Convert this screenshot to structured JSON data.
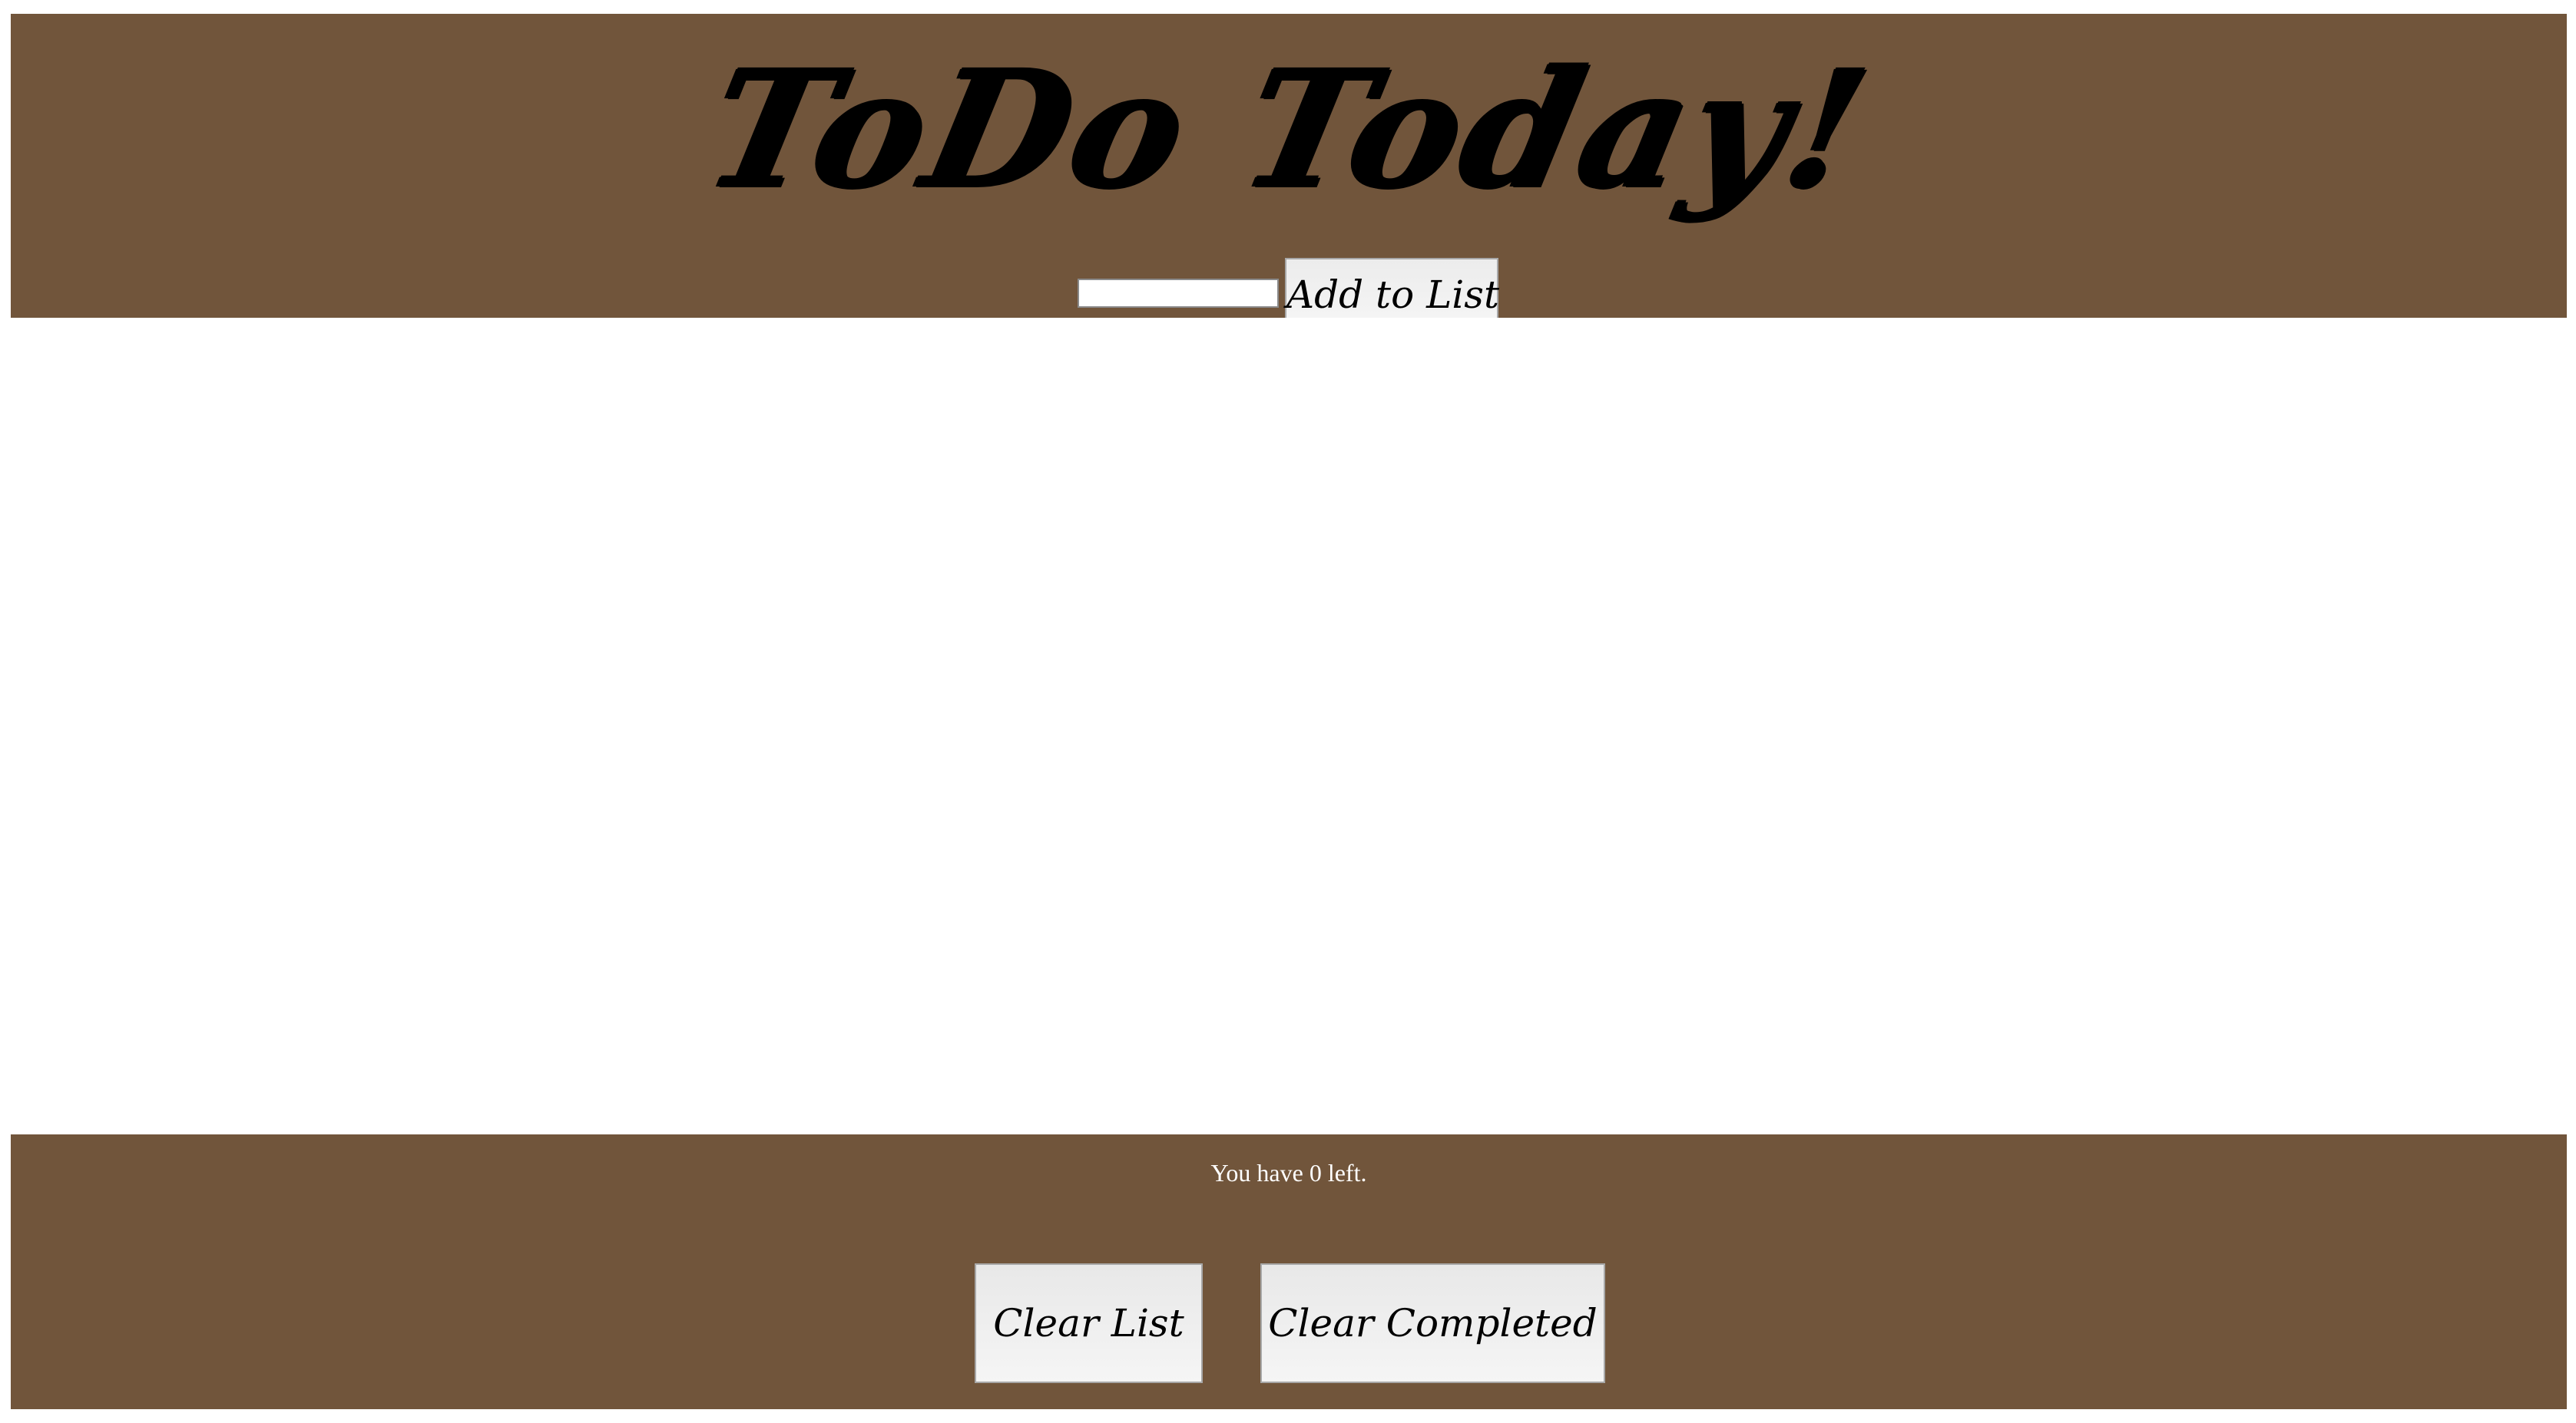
{
  "header": {
    "title": "ToDo Today!",
    "input_value": "",
    "add_button_label": "Add to List"
  },
  "list": {
    "items": []
  },
  "footer": {
    "remaining_text": "You have 0 left.",
    "clear_list_label": "Clear List",
    "clear_completed_label": "Clear Completed"
  },
  "colors": {
    "header_footer_bg": "#71553b",
    "page_bg": "#ffffff",
    "footer_text": "#ffffff"
  }
}
